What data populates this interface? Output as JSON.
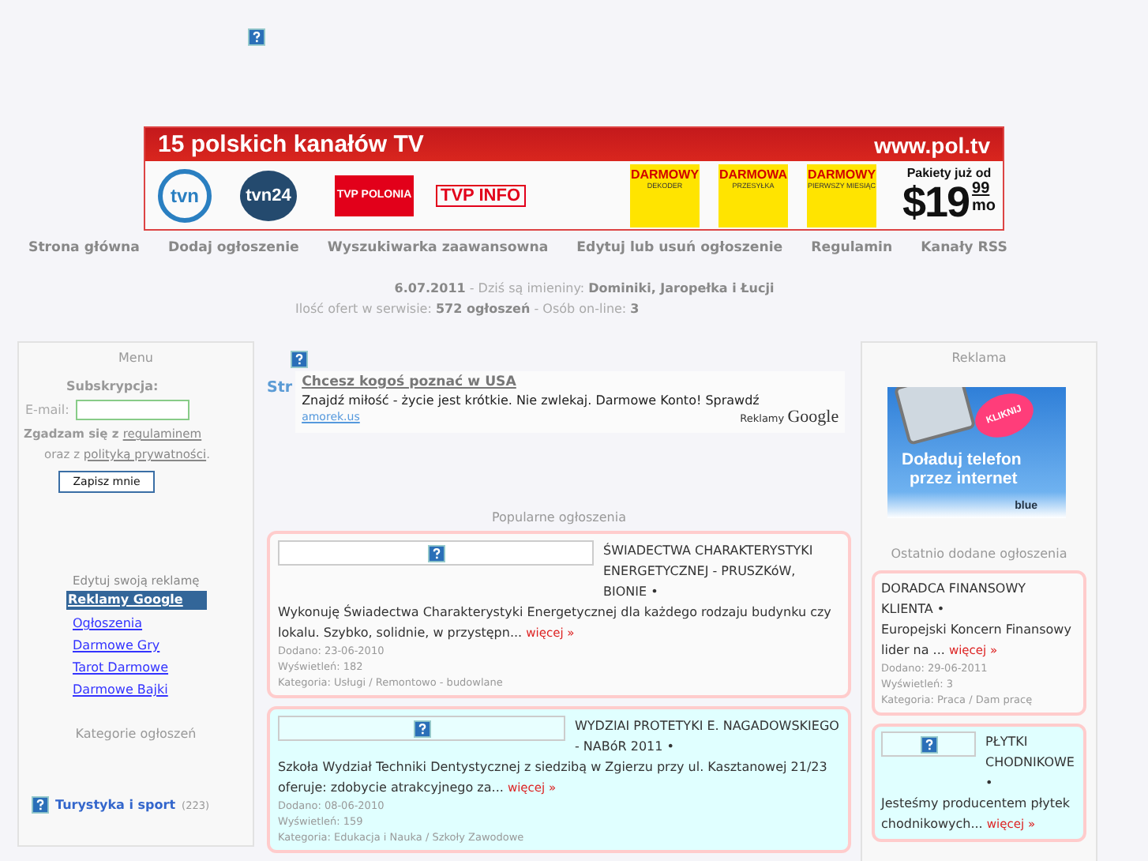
{
  "banner": {
    "headline": "15 polskich kanałów TV",
    "url": "www.pol.tv",
    "channels": [
      "tvn",
      "tvn24",
      "TVP POLONIA",
      "TVP INFO"
    ],
    "offers": [
      {
        "top": "DARMOWY",
        "bottom": "DEKODER"
      },
      {
        "top": "DARMOWA",
        "bottom": "PRZESYŁKA"
      },
      {
        "top": "DARMOWY",
        "bottom": "PIERWSZY MIESIĄC"
      }
    ],
    "price_label": "Pakiety już od",
    "price": "$19",
    "cents": "99",
    "period": "mo"
  },
  "nav": [
    "Strona główna",
    "Dodaj ogłoszenie",
    "Wyszukiwarka zaawansowna",
    "Edytuj lub usuń ogłoszenie",
    "Regulamin",
    "Kanały RSS"
  ],
  "info": {
    "date": "6.07.2011",
    "names_label": " - Dziś są imieniny: ",
    "names": "Dominiki, Jaropełka i Łucji",
    "offers_label": "Ilość ofert w serwisie: ",
    "offers": "572 ogłoszeń",
    "online_label": " - Osób on-line: ",
    "online": "3"
  },
  "left": {
    "title": "Menu",
    "subscribe": "Subskrypcja:",
    "email_label": "E-mail:",
    "agree": "Zgadzam się z ",
    "terms": "regulaminem",
    "and": "oraz z ",
    "privacy": "polityką prywatności",
    "dot": ".",
    "button": "Zapisz mnie",
    "edit_ad": "Edytuj swoją reklamę",
    "links": [
      {
        "label": "Reklamy Google",
        "selected": true
      },
      {
        "label": "Ogłoszenia",
        "selected": false
      },
      {
        "label": "Darmowe Gry",
        "selected": false
      },
      {
        "label": "Tarot Darmowe",
        "selected": false
      },
      {
        "label": "Darmowe Bajki",
        "selected": false
      }
    ],
    "categories_title": "Kategorie ogłoszeń",
    "categories": [
      {
        "label": "Turystyka i sport",
        "count": "(223)"
      }
    ]
  },
  "center": {
    "cut_text": "Str",
    "google_ad": {
      "title": "Chcesz kogoś poznać w USA",
      "text": "Znajdź miłość - życie jest krótkie. Nie zwlekaj. Darmowe Konto! Sprawdź",
      "link": "amorek.us",
      "label": "Reklamy",
      "brand": "Google"
    },
    "popular_title": "Popularne ogłoszenia",
    "cards": [
      {
        "color": "#fafafa",
        "has_image": true,
        "title": "ŚWIADECTWA CHARAKTERYSTYKI ENERGETYCZNEJ - PRUSZKóW, BIONIE •",
        "text": "Wykonuję Świadectwa Charakterystyki Energetycznej dla każdego rodzaju budynku czy lokalu. Szybko, solidnie, w przystępn...",
        "more": "więcej »",
        "meta": [
          "Dodano: 23-06-2010",
          "Wyświetleń: 182",
          "Kategoria: Usługi / Remontowo - budowlane"
        ]
      },
      {
        "color": "#e0ffff",
        "has_image": true,
        "title": "WYDZIAI PROTETYKI E. NAGADOWSKIEGO - NABóR 2011 •",
        "text": "Szkoła Wydział Techniki Dentystycznej z siedzibą w Zgierzu przy ul. Kasztanowej 21/23 oferuje: zdobycie atrakcyjnego za...",
        "more": "więcej »",
        "meta": [
          "Dodano: 08-06-2010",
          "Wyświetleń: 159",
          "Kategoria: Edukacja i Nauka / Szkoły Zawodowe"
        ]
      }
    ]
  },
  "right": {
    "title": "Reklama",
    "ad": {
      "badge": "KLIKNIJ",
      "line1": "Doładuj telefon",
      "line2": "przez internet",
      "brand": "blue"
    },
    "recent_title": "Ostatnio dodane ogłoszenia",
    "cards": [
      {
        "color": "#fafafa",
        "has_image": false,
        "title": "DORADCA FINANSOWY KLIENTA •",
        "text": "Europejski Koncern Finansowy lider na ...",
        "more": "więcej »",
        "meta": [
          "Dodano: 29-06-2011",
          "Wyświetleń: 3",
          "Kategoria: Praca / Dam pracę"
        ]
      },
      {
        "color": "#e0ffff",
        "has_image": true,
        "title": "PŁYTKI CHODNIKOWE •",
        "text": "Jesteśmy producentem płytek chodnikowych...",
        "more": "więcej »"
      }
    ]
  }
}
